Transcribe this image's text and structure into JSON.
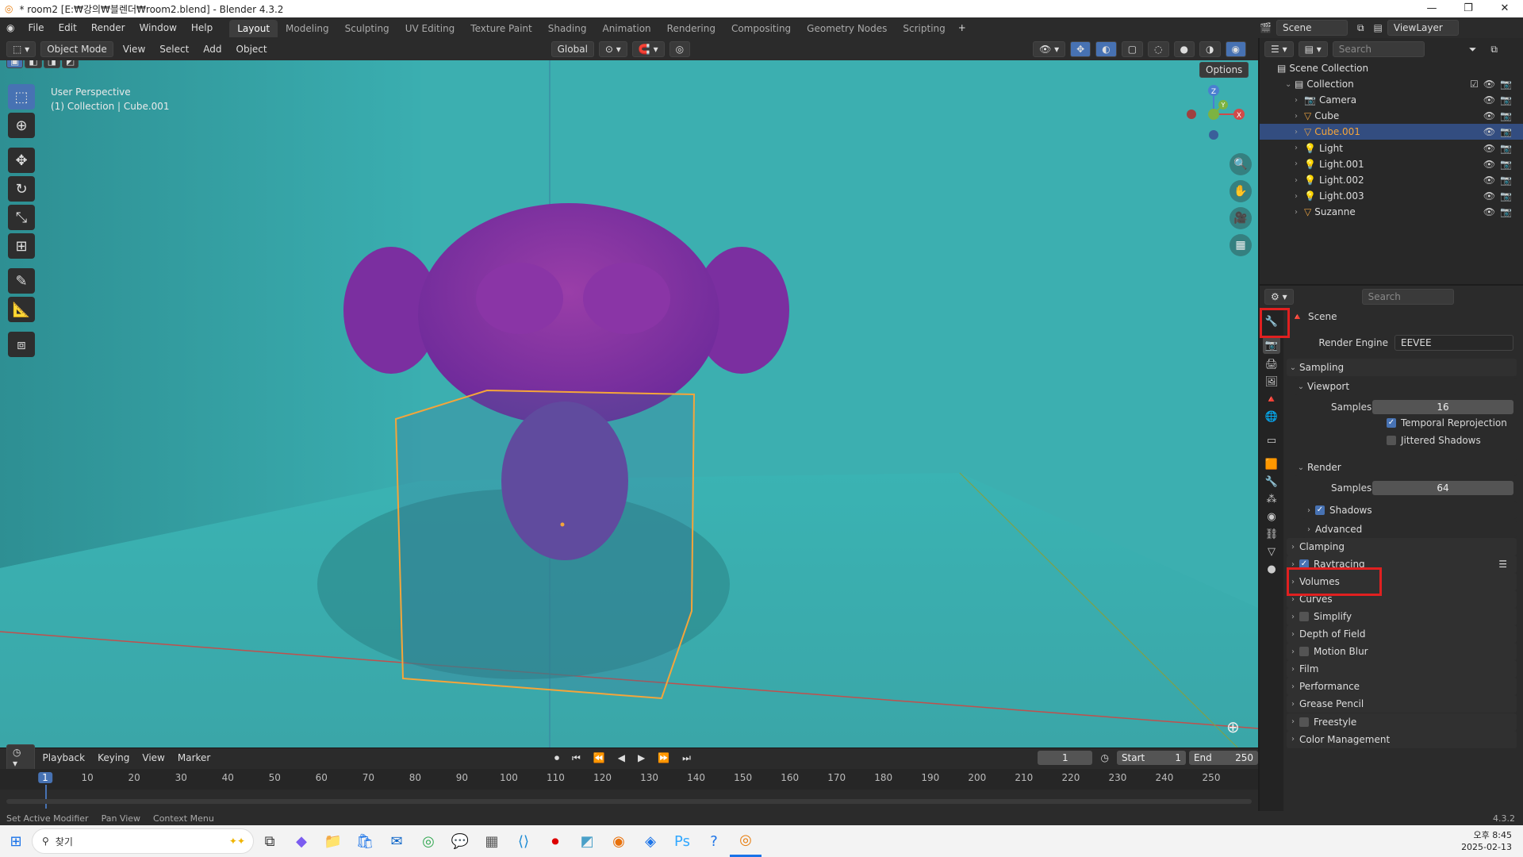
{
  "window": {
    "title": "* room2 [E:₩강의₩블렌더₩room2.blend] - Blender 4.3.2",
    "min": "—",
    "max": "❐",
    "close": "✕"
  },
  "menu": [
    "File",
    "Edit",
    "Render",
    "Window",
    "Help"
  ],
  "workspaces": [
    "Layout",
    "Modeling",
    "Sculpting",
    "UV Editing",
    "Texture Paint",
    "Shading",
    "Animation",
    "Rendering",
    "Compositing",
    "Geometry Nodes",
    "Scripting"
  ],
  "active_workspace": "Layout",
  "scene_name": "Scene",
  "view_layer": "ViewLayer",
  "viewport_header": {
    "mode": "Object Mode",
    "menus": [
      "View",
      "Select",
      "Add",
      "Object"
    ],
    "orientation": "Global",
    "options": "Options"
  },
  "viewport": {
    "perspective": "User Perspective",
    "collection_info": "(1) Collection | Cube.001",
    "gizmo": {
      "x": "X",
      "y": "Y",
      "z": "Z"
    }
  },
  "outliner": {
    "search_placeholder": "Search",
    "root": "Scene Collection",
    "collection": "Collection",
    "items": [
      "Camera",
      "Cube",
      "Cube.001",
      "Light",
      "Light.001",
      "Light.002",
      "Light.003",
      "Suzanne"
    ],
    "selected": "Cube.001"
  },
  "properties": {
    "search_placeholder": "Search",
    "context": "Scene",
    "render_engine_label": "Render Engine",
    "render_engine": "EEVEE",
    "sampling": "Sampling",
    "viewport": "Viewport",
    "samples_label": "Samples",
    "viewport_samples": "16",
    "temporal_reprojection": "Temporal Reprojection",
    "jittered_shadows": "Jittered Shadows",
    "render": "Render",
    "render_samples": "64",
    "shadows": "Shadows",
    "advanced": "Advanced",
    "clamping": "Clamping",
    "raytracing": "Raytracing",
    "volumes": "Volumes",
    "curves": "Curves",
    "simplify": "Simplify",
    "depth_of_field": "Depth of Field",
    "motion_blur": "Motion Blur",
    "film": "Film",
    "performance": "Performance",
    "grease_pencil": "Grease Pencil",
    "freestyle": "Freestyle",
    "color_management": "Color Management"
  },
  "timeline": {
    "menus": [
      "Playback",
      "Keying",
      "View",
      "Marker"
    ],
    "current_frame": "1",
    "start_label": "Start",
    "start": "1",
    "end_label": "End",
    "end": "250",
    "ticks": [
      "1",
      "10",
      "20",
      "30",
      "40",
      "50",
      "60",
      "70",
      "80",
      "90",
      "100",
      "110",
      "120",
      "130",
      "140",
      "150",
      "160",
      "170",
      "180",
      "190",
      "200",
      "210",
      "220",
      "230",
      "240",
      "250"
    ]
  },
  "status": {
    "left": "Set Active Modifier",
    "mid": "Pan View",
    "right": "Context Menu",
    "version": "4.3.2"
  },
  "taskbar": {
    "search": "찾기",
    "time": "오후 8:45",
    "date": "2025-02-13"
  },
  "colors": {
    "accent": "#4772b3",
    "highlight": "#e02020",
    "selection": "#f5a53a"
  }
}
